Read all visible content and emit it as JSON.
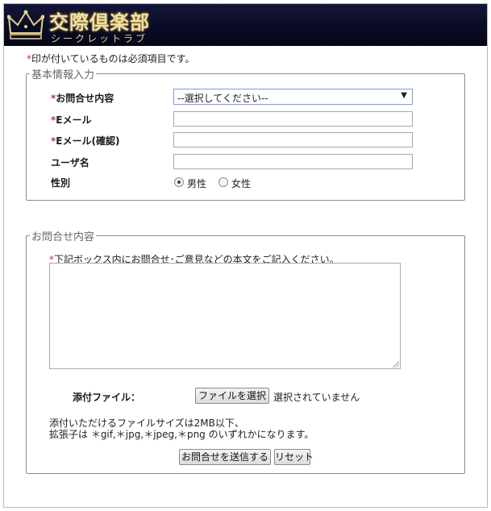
{
  "brand": {
    "title": "交際倶楽部",
    "subtitle": "シークレットラブ",
    "logo_icon": "crown-icon",
    "colors": {
      "banner": "#0a0c25",
      "gold": "#e6cf8a"
    }
  },
  "form": {
    "required_mark": "*",
    "required_note": "印が付いているものは必須項目です。",
    "basic_section": {
      "legend": "基本情報入力",
      "inquiry_label": "お問合せ内容",
      "inquiry_select_value": "--選択してください--",
      "email_label": "Eメール",
      "email_confirm_label": "Eメール(確認)",
      "username_label": "ユーザ名",
      "gender_label": "性別",
      "gender_options": [
        "男性",
        "女性"
      ],
      "gender_selected": "男性"
    },
    "inquiry_section": {
      "legend": "お問合せ内容",
      "instructions": "下記ボックス内にお問合せ･ご意見などの本文をご記入ください。",
      "attachment_label": "添付ファイル：",
      "choose_file_button": "ファイルを選択",
      "no_file_text": "選択されていません",
      "file_size_note": "添付いただけるファイルサイズは2MB以下、",
      "file_ext_note": "拡張子は ＊gif,＊jpg,＊jpeg,＊png のいずれかになります。",
      "submit_button": "お問合せを送信する",
      "reset_button": "リセット"
    }
  }
}
